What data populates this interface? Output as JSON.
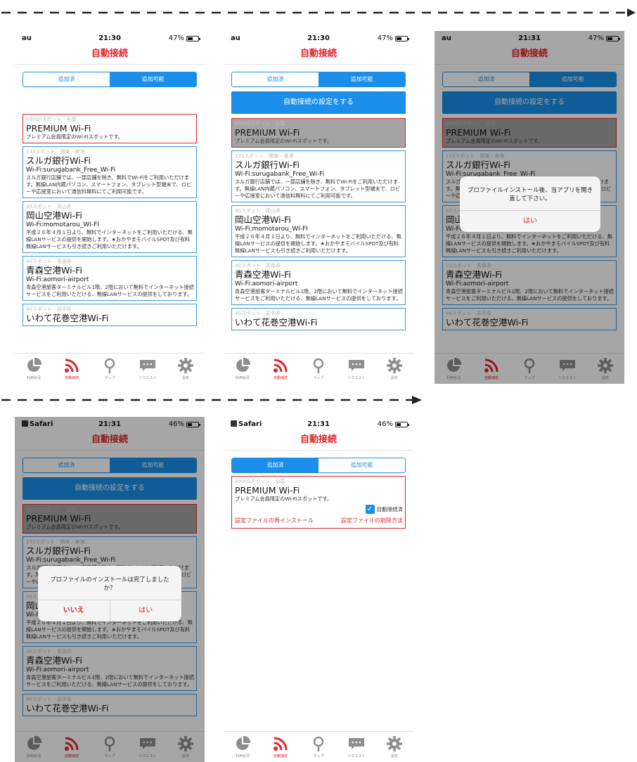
{
  "colors": {
    "accent": "#1a8ee8",
    "brand_red": "#e0242b",
    "card_grey": "#a4a4a4"
  },
  "app": {
    "title": "自動接続"
  },
  "status": {
    "carrier": "au",
    "safari_carrier": "Safari",
    "battery_47": "47%",
    "battery_46": "46%",
    "time_a": "21:30",
    "time_b": "21:31"
  },
  "segment": {
    "added": "追加済",
    "available": "追加可能"
  },
  "setup_button": "自動接続の設定をする",
  "cards": {
    "premium": {
      "meta": "69000スポット　全国",
      "name": "PREMIUM Wi-Fi",
      "desc": "プレミアム会員限定のWi-Fiスポットです。"
    },
    "suruga": {
      "meta": "133スポット　関東・東海",
      "name": "スルガ銀行Wi-Fi",
      "ssid": "Wi-Fi:surugabank_Free_Wi-Fi",
      "desc": "スルガ銀行店舗では、一部店舗を除き、無料でWi-Fiをご利用いただけます。無線LAN内蔵パソコン、スマートフォン、タブレット型端末で、ロビーや応接室において通信料無料にてご利用可能です。"
    },
    "okayama": {
      "meta": "40スポット　岡山県",
      "name": "岡山空港Wi-Fi",
      "ssid": "Wi-Fi:momotarou_WI-FI",
      "desc": "平成２６年４月１日より、無料でインターネットをご利用いただける、無線LANサービスの提供を開始します。★おかやまモバイルSPOT及び有料無線LANサービスも引き続きご利用いただけます。"
    },
    "aomori": {
      "meta": "40スポット　青森県",
      "name": "青森空港Wi-Fi",
      "ssid": "Wi-Fi:aomori-airport",
      "desc": "青森空港旅客ターミナルビル1階、2階において無料でインターネット接続サービスをご利用いただける、無線LANサービスの提供をしております。"
    },
    "iwate": {
      "meta": "40スポット　岩手県",
      "name": "いわて花巻空港Wi-Fi"
    }
  },
  "tabs": [
    {
      "label": "利用状況",
      "icon": "pie-chart-icon"
    },
    {
      "label": "自動接続",
      "icon": "wifi-signal-icon"
    },
    {
      "label": "マップ",
      "icon": "map-pin-icon"
    },
    {
      "label": "リクエスト",
      "icon": "speech-bubble-icon"
    },
    {
      "label": "設定",
      "icon": "gear-icon"
    }
  ],
  "dialogs": {
    "restart": {
      "message": "プロファイルインストール後、当アプリを開き直して下さい。",
      "ok": "はい"
    },
    "confirm": {
      "message": "プロファイルのインストールは完了しましたか？",
      "no": "いいえ",
      "yes": "はい"
    }
  },
  "installed": {
    "status_label": "自動接続済",
    "reinstall_link": "設定ファイルの再インストール",
    "delete_link": "設定ファイルの削除方法"
  }
}
